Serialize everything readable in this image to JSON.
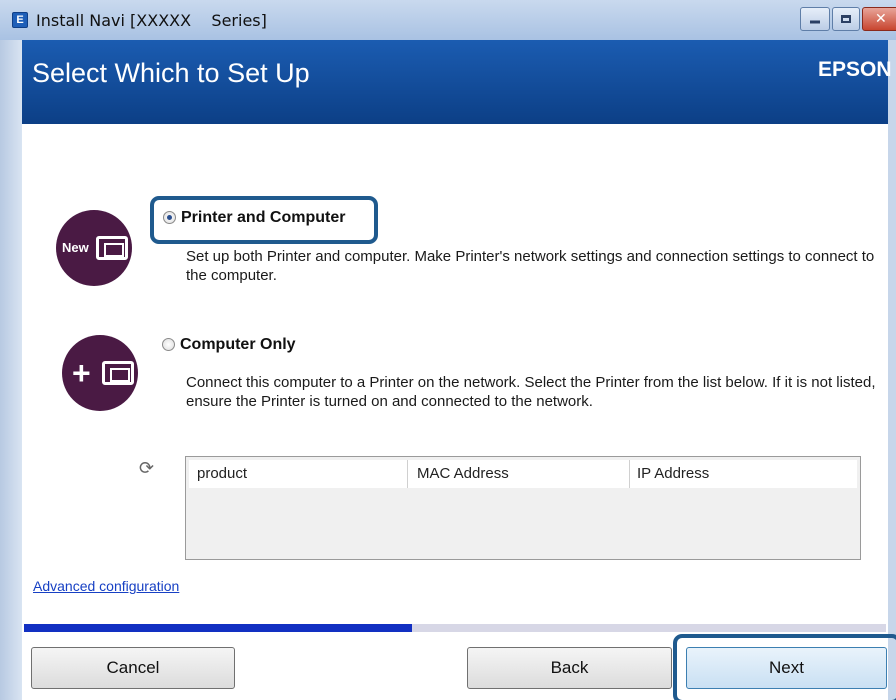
{
  "window": {
    "app_icon_letter": "E",
    "title": "Install Navi [XXXXX    Series]",
    "close_glyph": "✕"
  },
  "header": {
    "title": "Select Which to Set Up",
    "brand": "EPSON"
  },
  "options": [
    {
      "label": "Printer and Computer",
      "description": "Set up both Printer and computer. Make Printer's network settings and connection settings to connect to the computer.",
      "icon_tag": "New",
      "selected": true
    },
    {
      "label": "Computer Only",
      "description": "Connect this computer to a Printer on the network. Select the Printer from the list below. If it is not listed, ensure the Printer is turned on and connected to the network.",
      "icon_tag": "+",
      "selected": false
    }
  ],
  "printer_table": {
    "refresh_icon": "refresh-icon",
    "columns": [
      "product",
      "MAC Address",
      "IP Address"
    ],
    "rows": []
  },
  "links": {
    "advanced": "Advanced configuration"
  },
  "progress": {
    "fraction": 0.45
  },
  "buttons": {
    "cancel": "Cancel",
    "back": "Back",
    "next": "Next"
  },
  "colors": {
    "header_blue": "#0c3f86",
    "highlight": "#1f5a8e",
    "icon_purple": "#4a1a44",
    "progress": "#1230c2"
  }
}
